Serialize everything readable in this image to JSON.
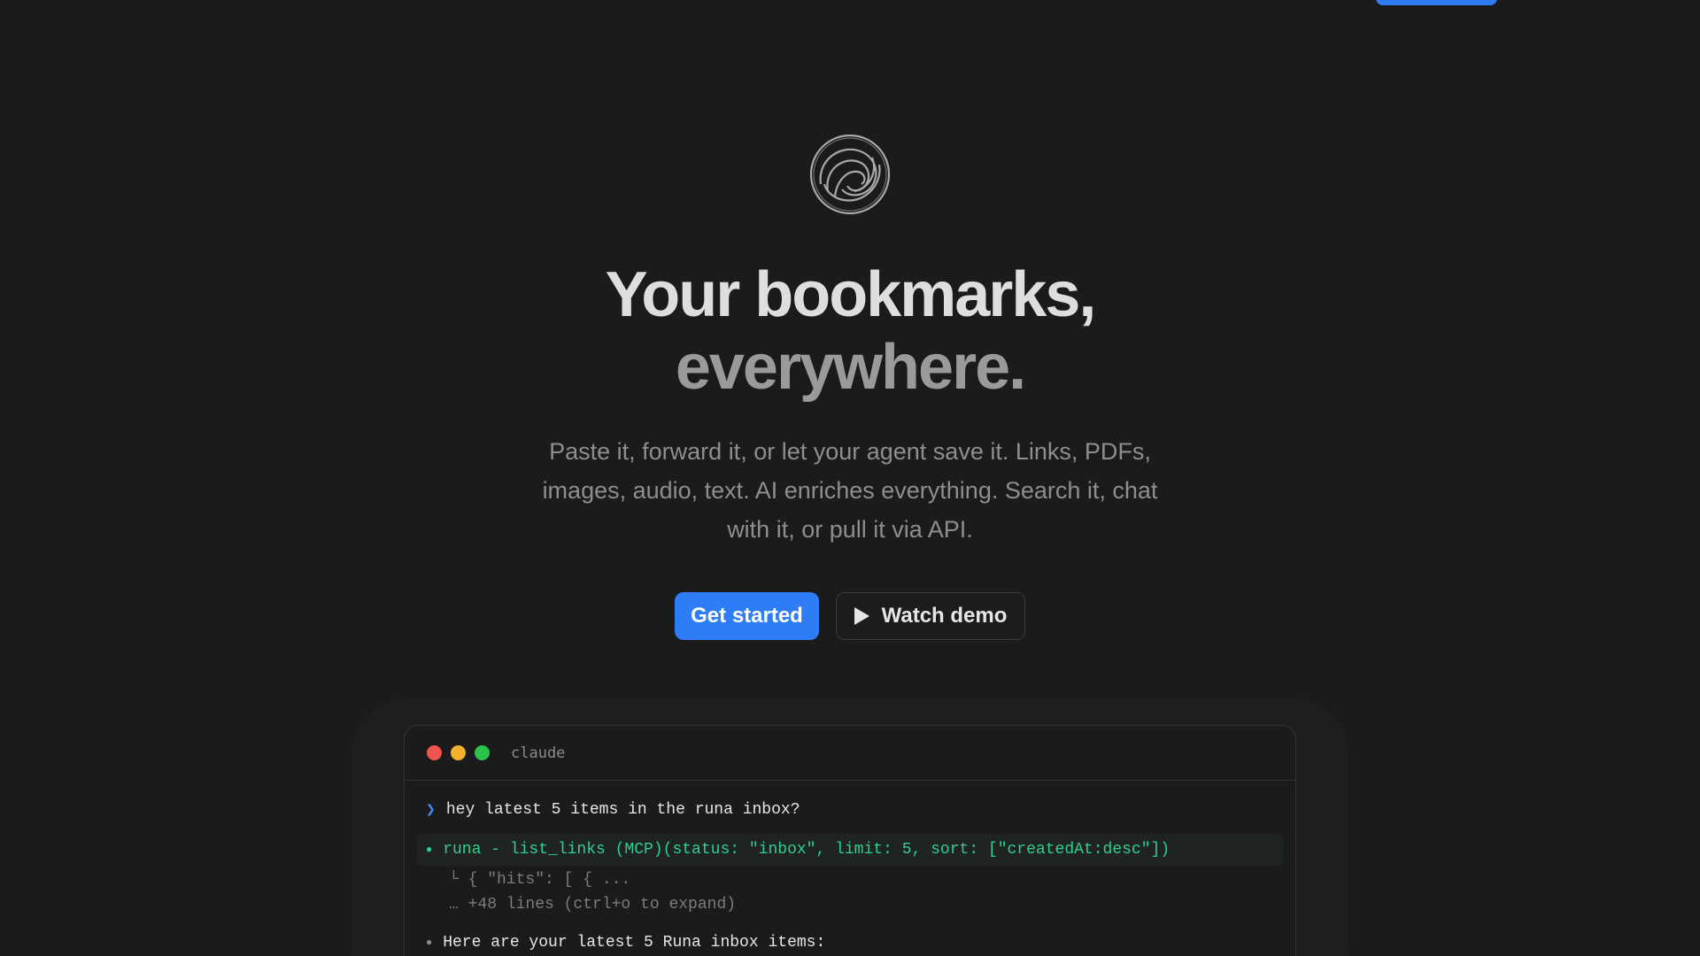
{
  "nav": {
    "cta_label": ""
  },
  "hero": {
    "headline_line1": "Your bookmarks,",
    "headline_line2": "everywhere.",
    "subtext_line1": "Paste it, forward it, or let your agent save it. Links, PDFs,",
    "subtext_line2": "images, audio, text. AI enriches everything. Search it, chat",
    "subtext_line3": "with it, or pull it via API.",
    "primary_button": "Get started",
    "secondary_button": "Watch demo",
    "logo_icon": "spiral-logo-icon",
    "play_icon": "play-icon"
  },
  "terminal": {
    "title": "claude",
    "prompt_symbol": "❯",
    "user_prompt": "hey latest 5 items in the runa inbox?",
    "tool_bullet": "●",
    "tool_call": "runa - list_links (MCP)(status: \"inbox\", limit: 5, sort: [\"createdAt:desc\"])",
    "result_line1": "└ { \"hits\": [ { ...",
    "result_line2": "… +48 lines (ctrl+o to expand)",
    "answer_bullet": "●",
    "answer": "Here are your latest 5 Runa inbox items:"
  },
  "colors": {
    "background": "#1b1b1c",
    "accent": "#2f7df6",
    "tool_green": "#2ecf8f",
    "dot_red": "#f0544f",
    "dot_yellow": "#f3b12b",
    "dot_green": "#2dc24c"
  }
}
